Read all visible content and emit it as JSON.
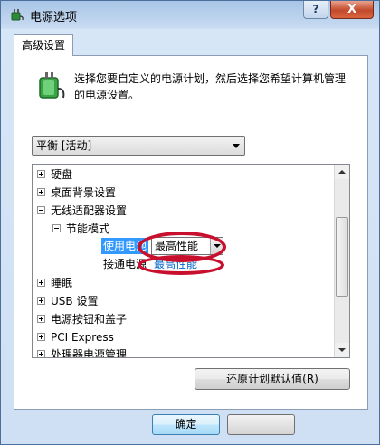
{
  "window": {
    "title": "电源选项",
    "help_label": "?",
    "close_label": "X"
  },
  "tab": {
    "label": "高级设置"
  },
  "description": "选择您要自定义的电源计划，然后选择您希望计算机管理的电源设置。",
  "plan_select": {
    "value": "平衡 [活动]"
  },
  "tree": {
    "items": [
      {
        "label": "硬盘",
        "expander": "+"
      },
      {
        "label": "桌面背景设置",
        "expander": "+"
      },
      {
        "label": "无线适配器设置",
        "expander": "-"
      },
      {
        "label": "节能模式",
        "expander": "-"
      },
      {
        "label": "睡眠",
        "expander": "+"
      },
      {
        "label": "USB 设置",
        "expander": "+"
      },
      {
        "label": "电源按钮和盖子",
        "expander": "+"
      },
      {
        "label": "PCI Express",
        "expander": "+"
      },
      {
        "label": "处理器电源管理",
        "expander": "+"
      }
    ],
    "on_battery_label": "使用电池",
    "on_battery_value": "最高性能",
    "plugged_in_label": "接通电源",
    "plugged_in_value": "最高性能"
  },
  "buttons": {
    "restore_label": "还原计划默认值(R)",
    "ok_label": "确定"
  },
  "colors": {
    "annotation": "#c8102e",
    "selection": "#3399ff",
    "link": "#0066cc"
  }
}
